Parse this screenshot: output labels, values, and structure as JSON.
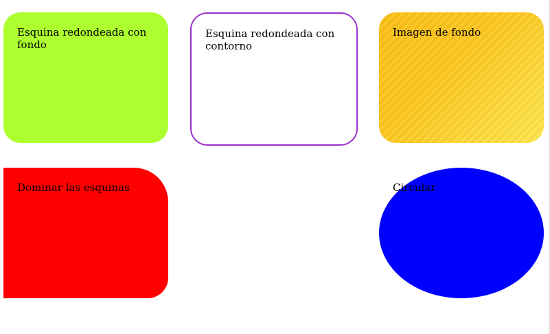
{
  "boxes": {
    "rounded_background": {
      "label": "Esquina redondeada con fondo",
      "color": "#adff2f"
    },
    "rounded_border": {
      "label": "Esquina redondeada con contorno",
      "border_color": "#9932cc"
    },
    "background_image": {
      "label": "Imagen de fondo",
      "color": "#fcc71f"
    },
    "corner_control": {
      "label": "Dominar las esquinas",
      "color": "#ff0000"
    },
    "circular": {
      "label": "Circular",
      "color": "#0000ff"
    }
  }
}
